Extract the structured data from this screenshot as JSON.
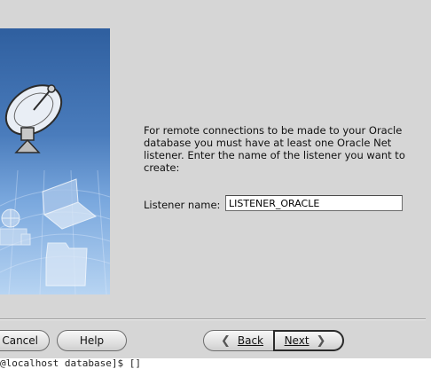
{
  "wizard": {
    "prompt": "For remote connections to be made to your Oracle\ndatabase you must have at least one Oracle Net\nlistener. Enter the name of the listener you want to\ncreate:",
    "listener_label": "Listener name:",
    "listener_value": "LISTENER_ORACLE"
  },
  "buttons": {
    "cancel": "Cancel",
    "help": "Help",
    "back": "Back",
    "next": "Next"
  },
  "terminal": {
    "line": "@localhost database]$ []"
  },
  "icons": {
    "back": "chevron-left-icon",
    "next": "chevron-right-icon"
  }
}
